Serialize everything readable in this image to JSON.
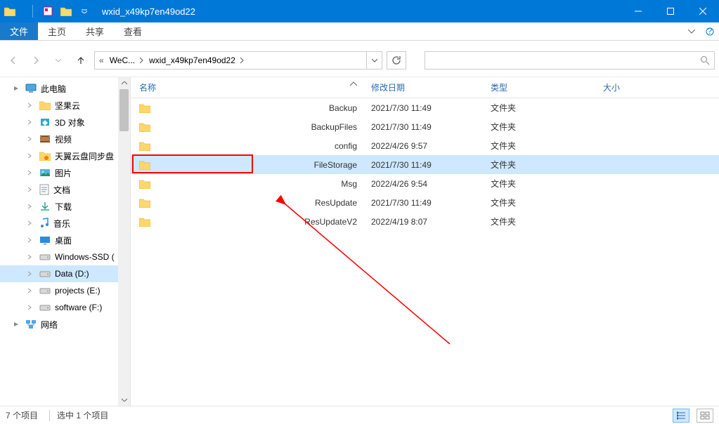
{
  "title": "wxid_x49kp7en49od22",
  "ribbon": {
    "tabs": [
      "文件",
      "主页",
      "共享",
      "查看"
    ],
    "active_index": 0
  },
  "breadcrumb": {
    "segments": [
      "WeC...",
      "wxid_x49kp7en49od22"
    ],
    "history_icon": "«"
  },
  "search": {
    "icon": "magnifier"
  },
  "sidebar": {
    "items": [
      {
        "label": "此电脑",
        "icon": "pc",
        "indent": 0
      },
      {
        "label": "坚果云",
        "icon": "folder",
        "indent": 1
      },
      {
        "label": "3D 对象",
        "icon": "3d",
        "indent": 1
      },
      {
        "label": "视频",
        "icon": "video",
        "indent": 1
      },
      {
        "label": "天翼云盘同步盘",
        "icon": "cloud-folder",
        "indent": 1
      },
      {
        "label": "图片",
        "icon": "pictures",
        "indent": 1
      },
      {
        "label": "文档",
        "icon": "docs",
        "indent": 1
      },
      {
        "label": "下载",
        "icon": "download",
        "indent": 1
      },
      {
        "label": "音乐",
        "icon": "music",
        "indent": 1
      },
      {
        "label": "桌面",
        "icon": "desktop",
        "indent": 1
      },
      {
        "label": "Windows-SSD (",
        "icon": "drive",
        "indent": 1
      },
      {
        "label": "Data (D:)",
        "icon": "drive",
        "indent": 1,
        "selected": true
      },
      {
        "label": "projects (E:)",
        "icon": "drive",
        "indent": 1
      },
      {
        "label": "software (F:)",
        "icon": "drive",
        "indent": 1
      },
      {
        "label": "网络",
        "icon": "network",
        "indent": 0
      }
    ]
  },
  "columns": {
    "name": "名称",
    "date": "修改日期",
    "type": "类型",
    "size": "大小"
  },
  "rows": [
    {
      "name": "Backup",
      "date": "2021/7/30 11:49",
      "type": "文件夹"
    },
    {
      "name": "BackupFiles",
      "date": "2021/7/30 11:49",
      "type": "文件夹"
    },
    {
      "name": "config",
      "date": "2022/4/26 9:57",
      "type": "文件夹"
    },
    {
      "name": "FileStorage",
      "date": "2021/7/30 11:49",
      "type": "文件夹",
      "selected": true,
      "boxed": true
    },
    {
      "name": "Msg",
      "date": "2022/4/26 9:54",
      "type": "文件夹"
    },
    {
      "name": "ResUpdate",
      "date": "2021/7/30 11:49",
      "type": "文件夹"
    },
    {
      "name": "ResUpdateV2",
      "date": "2022/4/19 8:07",
      "type": "文件夹"
    }
  ],
  "status": {
    "count": "7 个项目",
    "selection": "选中 1 个项目"
  }
}
